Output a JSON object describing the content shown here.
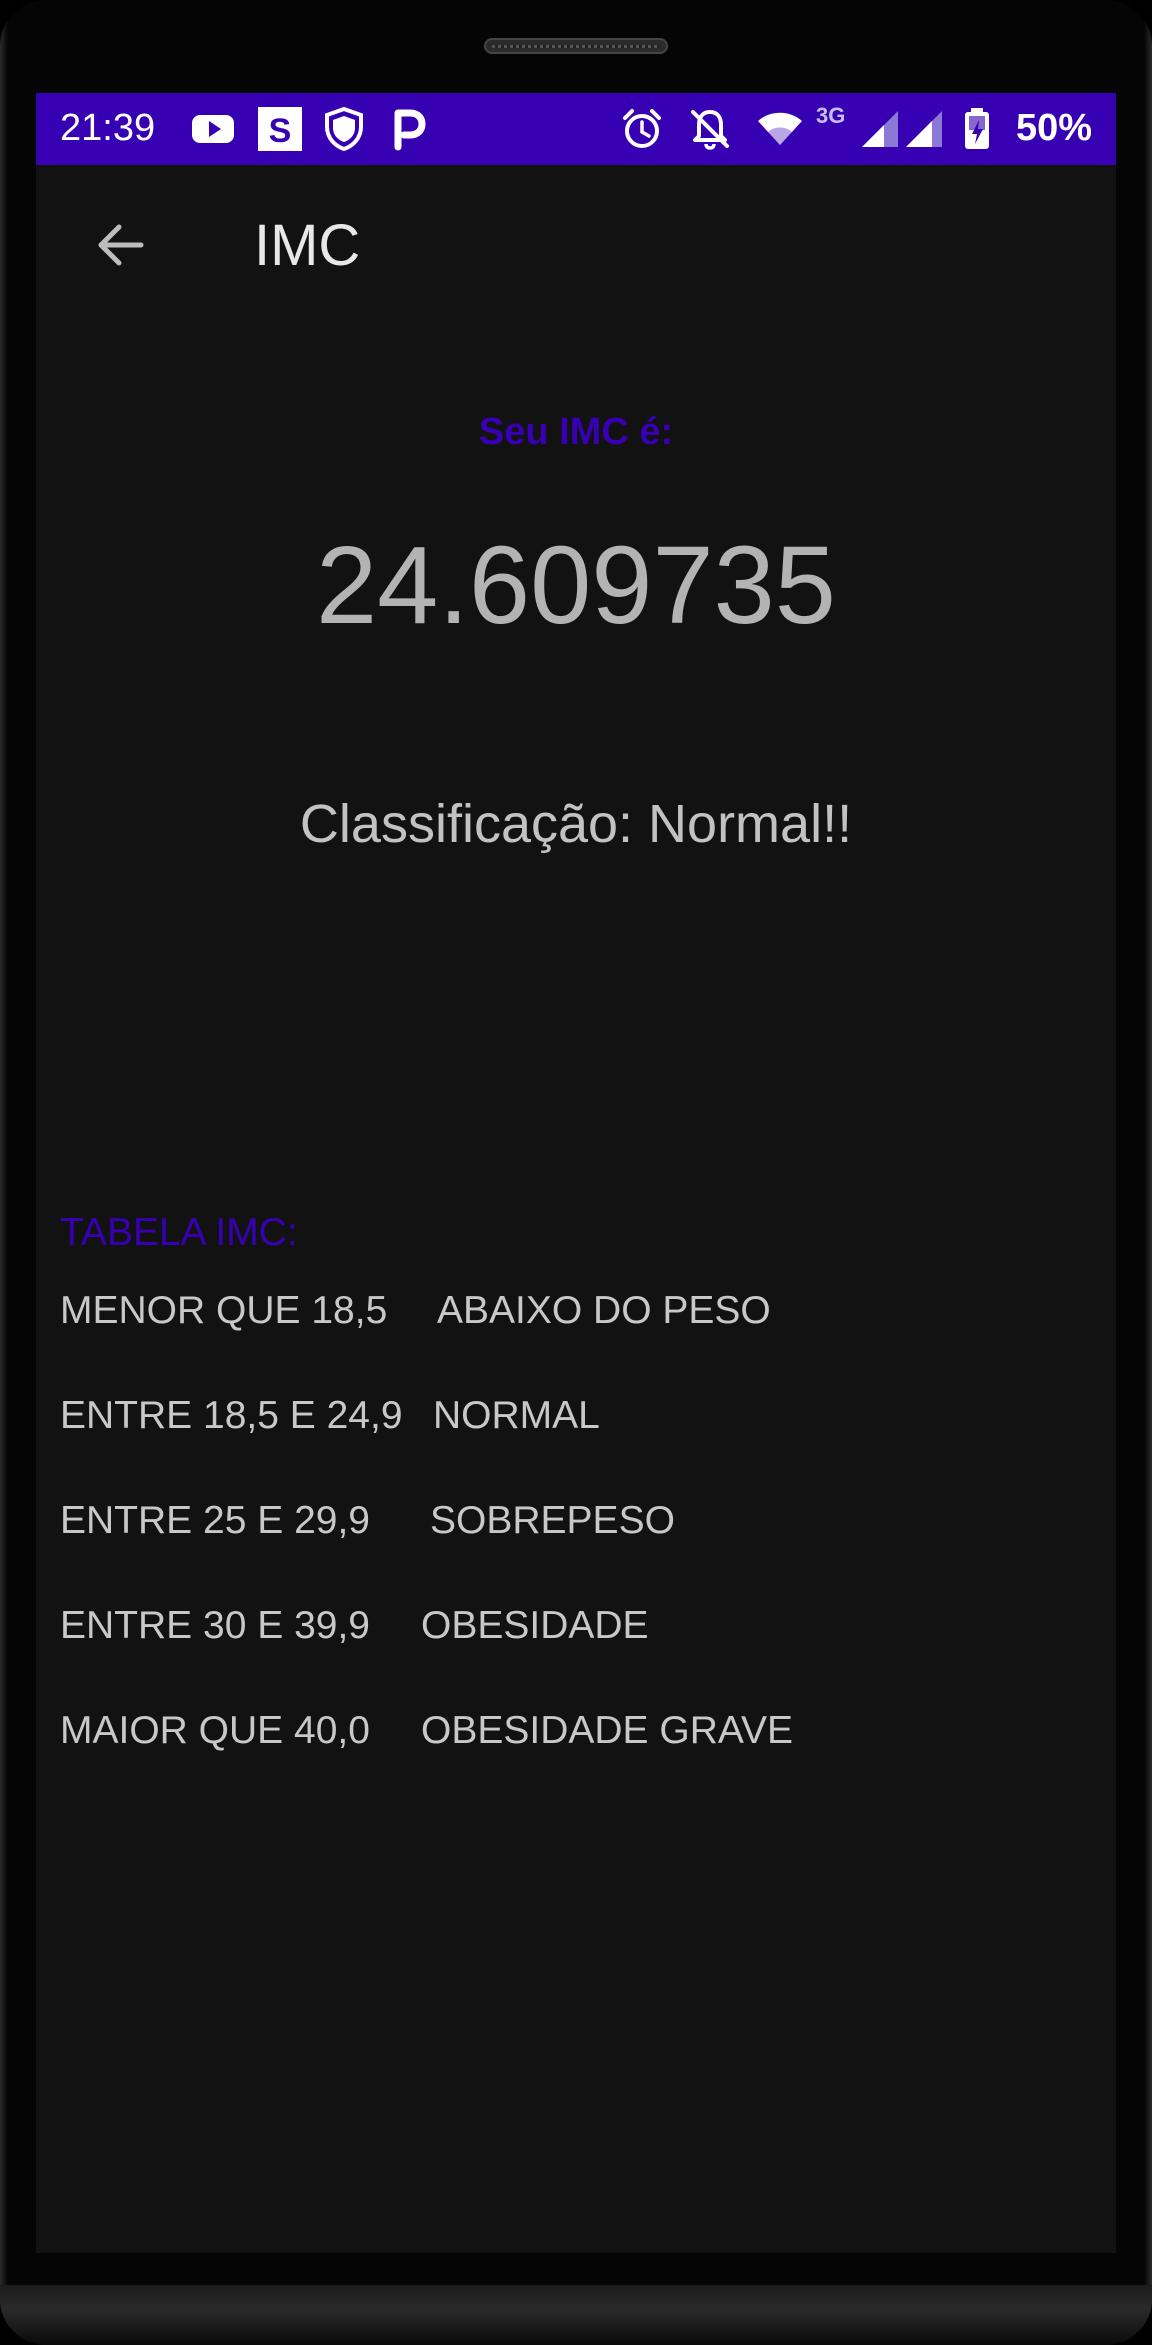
{
  "status_bar": {
    "time": "21:39",
    "icons_left": [
      "youtube-icon",
      "s-app-icon",
      "shield-icon",
      "p-app-icon"
    ],
    "icons_right": [
      "alarm-icon",
      "notifications-off-icon",
      "wifi-icon",
      "signal-3g-icon",
      "signal-icon",
      "battery-icon"
    ],
    "network_label": "3G",
    "battery": "50%",
    "background_color": "#3700b3"
  },
  "toolbar": {
    "back_icon": "arrow-back-icon",
    "title": "IMC"
  },
  "result": {
    "label": "Seu IMC é:",
    "value": "24.609735",
    "classification": "Classificação: Normal!!",
    "label_color": "#3700b3"
  },
  "table": {
    "title": "TABELA IMC:",
    "rows": [
      {
        "range": "MENOR QUE 18,5",
        "category": "ABAIXO DO PESO"
      },
      {
        "range": "ENTRE 18,5 E 24,9",
        "category": "NORMAL"
      },
      {
        "range": "ENTRE 25 E 29,9",
        "category": "SOBREPESO"
      },
      {
        "range": "ENTRE 30 E 39,9",
        "category": "OBESIDADE"
      },
      {
        "range": "MAIOR QUE 40,0",
        "category": "OBESIDADE GRAVE"
      }
    ]
  },
  "colors": {
    "accent": "#3700b3",
    "background": "#121212",
    "text": "#c8c8c8"
  }
}
